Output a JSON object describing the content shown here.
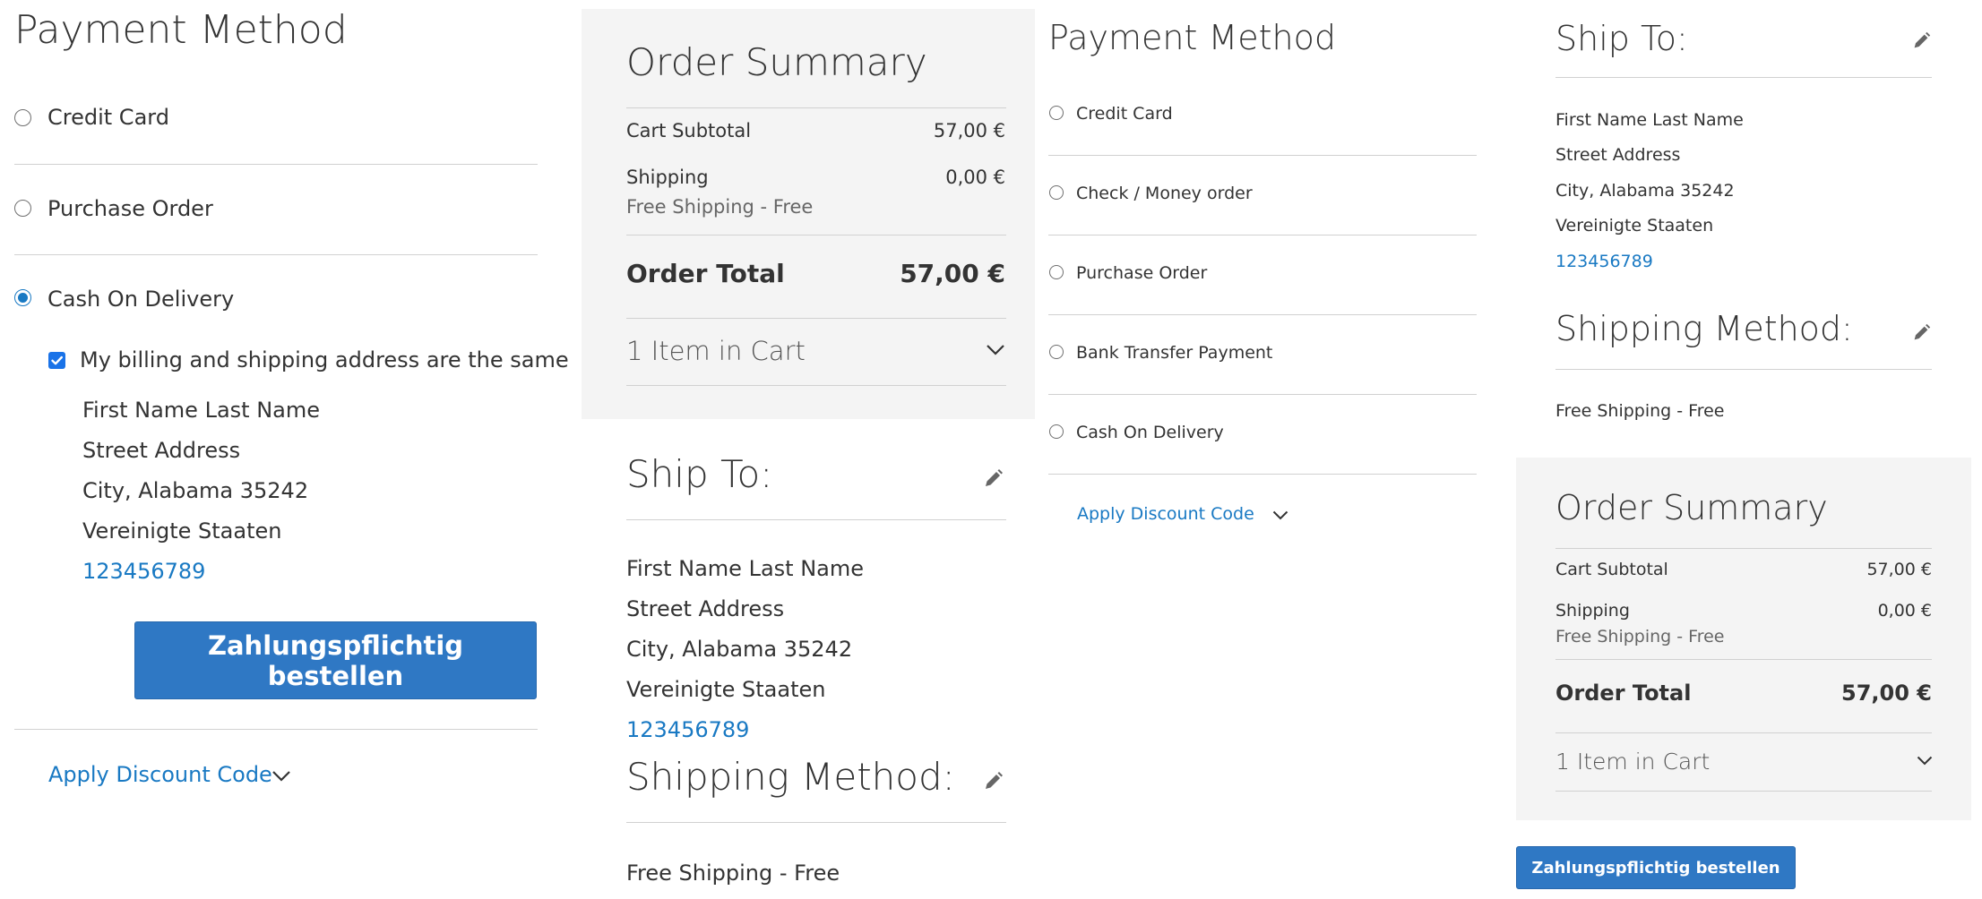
{
  "panel1": {
    "title": "Payment Method",
    "methods": [
      {
        "label": "Credit Card",
        "selected": false
      },
      {
        "label": "Purchase Order",
        "selected": false
      },
      {
        "label": "Cash On Delivery",
        "selected": true
      }
    ],
    "same_address_label": "My billing and shipping address are the same",
    "same_address_checked": true,
    "address": {
      "name": "First Name Last Name",
      "street": "Street Address",
      "city": "City, Alabama 35242",
      "country": "Vereinigte Staaten",
      "phone": "123456789"
    },
    "place_order_label": "Zahlungspflichtig bestellen",
    "discount_label": "Apply Discount Code"
  },
  "panel2": {
    "summary": {
      "title": "Order Summary",
      "subtotal_label": "Cart Subtotal",
      "subtotal_value": "57,00 €",
      "shipping_label": "Shipping",
      "shipping_value": "0,00 €",
      "shipping_method": "Free Shipping - Free",
      "total_label": "Order Total",
      "total_value": "57,00 €",
      "items_label": "1 Item in Cart"
    },
    "ship_to": {
      "title": "Ship To:",
      "name": "First Name Last Name",
      "street": "Street Address",
      "city": "City, Alabama 35242",
      "country": "Vereinigte Staaten",
      "phone": "123456789"
    },
    "shipping_method": {
      "title": "Shipping Method:",
      "value": "Free Shipping - Free"
    }
  },
  "panel3": {
    "title": "Payment Method",
    "methods": [
      {
        "label": "Credit Card",
        "selected": false
      },
      {
        "label": "Check / Money order",
        "selected": false
      },
      {
        "label": "Purchase Order",
        "selected": false
      },
      {
        "label": "Bank Transfer Payment",
        "selected": false
      },
      {
        "label": "Cash On Delivery",
        "selected": false
      }
    ],
    "discount_label": "Apply Discount Code"
  },
  "panel4": {
    "ship_to": {
      "title": "Ship To:",
      "name": "First Name Last Name",
      "street": "Street Address",
      "city": "City, Alabama 35242",
      "country": "Vereinigte Staaten",
      "phone": "123456789"
    },
    "shipping_method": {
      "title": "Shipping Method:",
      "value": "Free Shipping - Free"
    },
    "summary": {
      "title": "Order Summary",
      "subtotal_label": "Cart Subtotal",
      "subtotal_value": "57,00 €",
      "shipping_label": "Shipping",
      "shipping_value": "0,00 €",
      "shipping_method": "Free Shipping - Free",
      "total_label": "Order Total",
      "total_value": "57,00 €",
      "items_label": "1 Item in Cart"
    },
    "place_order_label": "Zahlungspflichtig bestellen"
  },
  "colors": {
    "accent": "#1979c3",
    "button": "#2f78c4",
    "summary_bg": "#f4f4f4",
    "divider": "#d1d1d1"
  },
  "icons": {
    "edit": "pencil-icon",
    "expand": "chevron-down-icon"
  }
}
